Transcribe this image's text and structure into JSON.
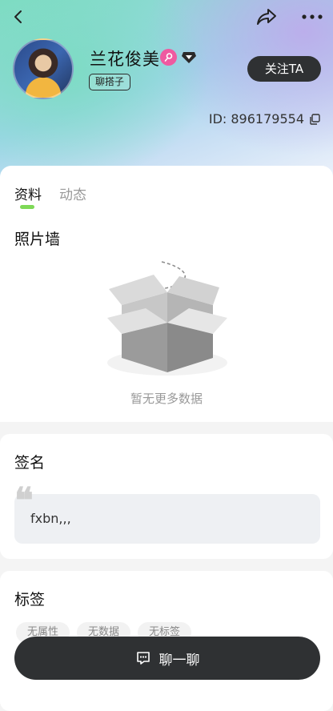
{
  "profile": {
    "name": "兰花俊美",
    "role_tag": "聊搭子",
    "follow_label": "关注TA",
    "id_text": "ID: 896179554"
  },
  "tabs": [
    {
      "label": "资料",
      "active": true
    },
    {
      "label": "动态",
      "active": false
    }
  ],
  "photo_wall": {
    "title": "照片墙",
    "empty_text": "暂无更多数据"
  },
  "signature": {
    "title": "签名",
    "text": "fxbn,,,"
  },
  "tags": {
    "title": "标签",
    "items": [
      "无属性",
      "无数据",
      "无标签"
    ]
  },
  "chat_button": {
    "label": "聊一聊"
  },
  "icons": {
    "back": "chevron-left-icon",
    "share": "share-arrow-icon",
    "more": "more-dots-icon",
    "pink_badge": "pink-badge-icon",
    "diamond_badge": "diamond-icon",
    "copy": "copy-icon",
    "chat": "chat-bubble-icon"
  },
  "colors": {
    "accent": "#7ed957",
    "dark_button": "#2f3133",
    "badge_pink": "#ef5aa0"
  }
}
